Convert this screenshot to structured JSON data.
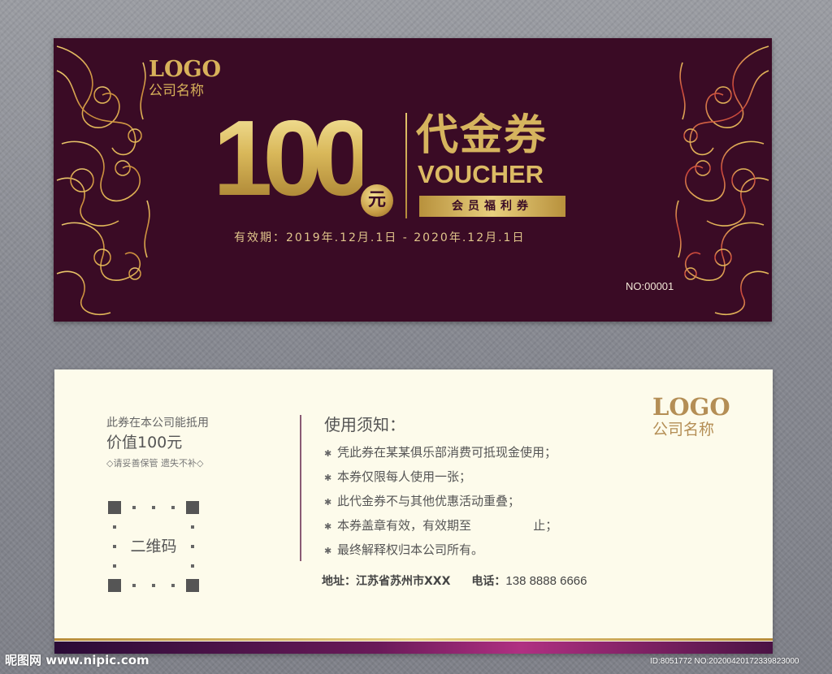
{
  "front": {
    "logo": "LOGO",
    "company_name": "公司名称",
    "amount": "100",
    "currency": "元",
    "title_cn": "代金券",
    "title_en": "VOUCHER",
    "member_label": "会员福利券",
    "validity": "有效期：2019年.12月.1日 - 2020年.12月.1日",
    "serial": "NO:00001"
  },
  "back": {
    "usage_line1": "此券在本公司能抵用",
    "usage_line2": "价值100元",
    "keep_note": "◇请妥善保管 遗失不补◇",
    "qr_label": "二维码",
    "notice_title": "使用须知：",
    "notices": [
      "凭此券在某某俱乐部消费可抵现金使用；",
      "本券仅限每人使用一张；",
      "此代金券不与其他优惠活动重叠；",
      "本券盖章有效，有效期至                止；",
      "最终解释权归本公司所有。"
    ],
    "bullet": "✱",
    "address_label": "地址：",
    "address": "江苏省苏州市XXX",
    "phone_label": "电话：",
    "phone": "138 8888 6666",
    "logo": "LOGO",
    "company_name": "公司名称"
  },
  "watermark": {
    "left": "昵图网 www.nipic.com",
    "right": "ID:8051772 NO:20200420172339823000"
  },
  "colors": {
    "front_bg": "#3a0b25",
    "gold": "#d8b25a",
    "back_bg": "#fdfbeb",
    "accent_purple": "#b03082"
  }
}
